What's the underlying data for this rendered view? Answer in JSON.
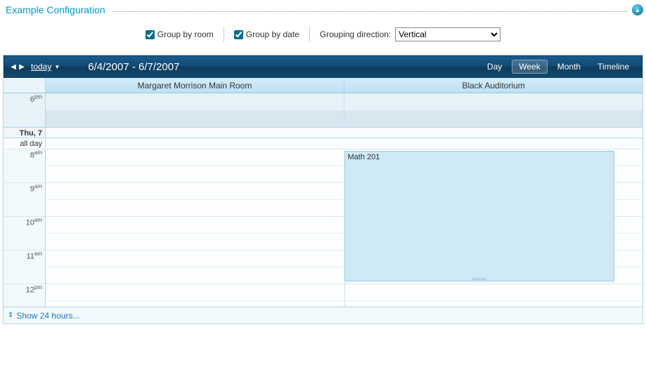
{
  "config": {
    "title": "Example Configuration",
    "group_by_room": {
      "label": "Group by room",
      "checked": true
    },
    "group_by_date": {
      "label": "Group by date",
      "checked": true
    },
    "grouping_direction": {
      "label": "Grouping direction:",
      "value": "Vertical"
    }
  },
  "toolbar": {
    "today_label": "today",
    "date_range": "6/4/2007 - 6/7/2007",
    "views": {
      "day": "Day",
      "week": "Week",
      "month": "Month",
      "timeline": "Timeline",
      "active": "week"
    }
  },
  "rooms": [
    "Margaret Morrison Main Room",
    "Black Auditorium"
  ],
  "day_divider": {
    "label": "Thu, 7"
  },
  "all_day_label": "all day",
  "time_slots_top": [
    {
      "hour": "6",
      "suffix": "pm"
    }
  ],
  "time_slots": [
    {
      "hour": "8",
      "suffix": "am"
    },
    {
      "hour": "9",
      "suffix": "am"
    },
    {
      "hour": "10",
      "suffix": "am"
    },
    {
      "hour": "11",
      "suffix": "am"
    },
    {
      "hour": "12",
      "suffix": "pm"
    }
  ],
  "appointment": {
    "title": "Math 201",
    "room_index": 1,
    "start_slot": 0,
    "duration_slots": 4
  },
  "footer": {
    "show_24_hours": "Show 24 hours..."
  }
}
